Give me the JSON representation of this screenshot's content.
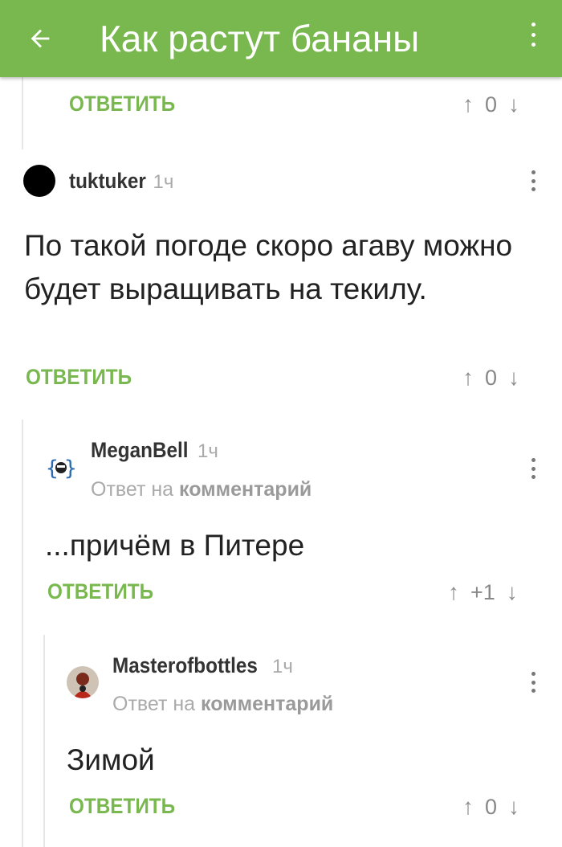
{
  "appbar": {
    "back_icon": "arrow-left-icon",
    "title": "Как растут бананы",
    "menu_icon": "more-vertical-icon"
  },
  "accent_color": "#79b84f",
  "comments": [
    {
      "reply_label": "ОТВЕТИТЬ",
      "votes": "0"
    },
    {
      "username": "tuktuker",
      "time": "1ч",
      "text": "По такой погоде скоро агаву можно будет выращивать на текилу.",
      "reply_label": "ОТВЕТИТЬ",
      "votes": "0"
    },
    {
      "username": "MeganBell",
      "time": "1ч",
      "reply_to_prefix": "Ответ на",
      "reply_to_link": "комментарий",
      "text": "...причём в Питере",
      "reply_label": "ОТВЕТИТЬ",
      "votes": "+1"
    },
    {
      "username": "Masterofbottles",
      "time": "1ч",
      "reply_to_prefix": "Ответ на",
      "reply_to_link": "комментарий",
      "text": "Зимой",
      "reply_label": "ОТВЕТИТЬ",
      "votes": "0"
    }
  ]
}
